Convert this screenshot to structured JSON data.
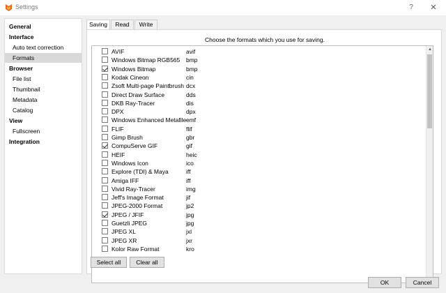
{
  "window": {
    "title": "Settings",
    "help_label": "?",
    "close_label": "✕",
    "icon": "app-logo-icon",
    "accent": "#e8631a"
  },
  "sidebar": {
    "items": [
      {
        "label": "General",
        "level": 0
      },
      {
        "label": "Interface",
        "level": 0
      },
      {
        "label": "Auto text correction",
        "level": 1
      },
      {
        "label": "Formats",
        "level": 1,
        "selected": true
      },
      {
        "label": "Browser",
        "level": 0
      },
      {
        "label": "File list",
        "level": 1
      },
      {
        "label": "Thumbnail",
        "level": 1
      },
      {
        "label": "Metadata",
        "level": 1
      },
      {
        "label": "Catalog",
        "level": 1
      },
      {
        "label": "View",
        "level": 0
      },
      {
        "label": "Fullscreen",
        "level": 1
      },
      {
        "label": "Integration",
        "level": 0
      }
    ]
  },
  "tabs": [
    {
      "label": "Saving",
      "active": true
    },
    {
      "label": "Read",
      "active": false
    },
    {
      "label": "Write",
      "active": false
    }
  ],
  "panel": {
    "hint": "Choose the formats which you use for saving."
  },
  "formats": [
    {
      "name": "AVIF",
      "ext": "avif",
      "checked": false
    },
    {
      "name": "Windows Bitmap RGB565",
      "ext": "bmp",
      "checked": false
    },
    {
      "name": "Windows Bitmap",
      "ext": "bmp",
      "checked": true
    },
    {
      "name": "Kodak Cineon",
      "ext": "cin",
      "checked": false
    },
    {
      "name": "Zsoft Multi-page Paintbrush",
      "ext": "dcx",
      "checked": false
    },
    {
      "name": "Direct Draw Surface",
      "ext": "dds",
      "checked": false
    },
    {
      "name": "DKB Ray-Tracer",
      "ext": "dis",
      "checked": false
    },
    {
      "name": "DPX",
      "ext": "dpx",
      "checked": false
    },
    {
      "name": "Windows Enhanced Metafile",
      "ext": "emf",
      "checked": false
    },
    {
      "name": "FLIF",
      "ext": "flif",
      "checked": false
    },
    {
      "name": "Gimp Brush",
      "ext": "gbr",
      "checked": false
    },
    {
      "name": "CompuServe GIF",
      "ext": "gif",
      "checked": true
    },
    {
      "name": "HEIF",
      "ext": "heic",
      "checked": false
    },
    {
      "name": "Windows Icon",
      "ext": "ico",
      "checked": false
    },
    {
      "name": "Explore (TDI) & Maya",
      "ext": "iff",
      "checked": false
    },
    {
      "name": "Amiga IFF",
      "ext": "iff",
      "checked": false
    },
    {
      "name": "Vivid Ray-Tracer",
      "ext": "img",
      "checked": false
    },
    {
      "name": "Jeff's Image Format",
      "ext": "jif",
      "checked": false
    },
    {
      "name": "JPEG-2000 Format",
      "ext": "jp2",
      "checked": false
    },
    {
      "name": "JPEG / JFIF",
      "ext": "jpg",
      "checked": true
    },
    {
      "name": "Guetzli JPEG",
      "ext": "jpg",
      "checked": false
    },
    {
      "name": "JPEG XL",
      "ext": "jxl",
      "checked": false
    },
    {
      "name": "JPEG XR",
      "ext": "jxr",
      "checked": false
    },
    {
      "name": "Kolor Raw Format",
      "ext": "kro",
      "checked": false
    }
  ],
  "scroll": {
    "up_arrow": "▲",
    "down_arrow": "▼",
    "position": 0.0
  },
  "buttons": {
    "select_all": "Select all",
    "clear_all": "Clear all",
    "ok": "OK",
    "cancel": "Cancel"
  }
}
